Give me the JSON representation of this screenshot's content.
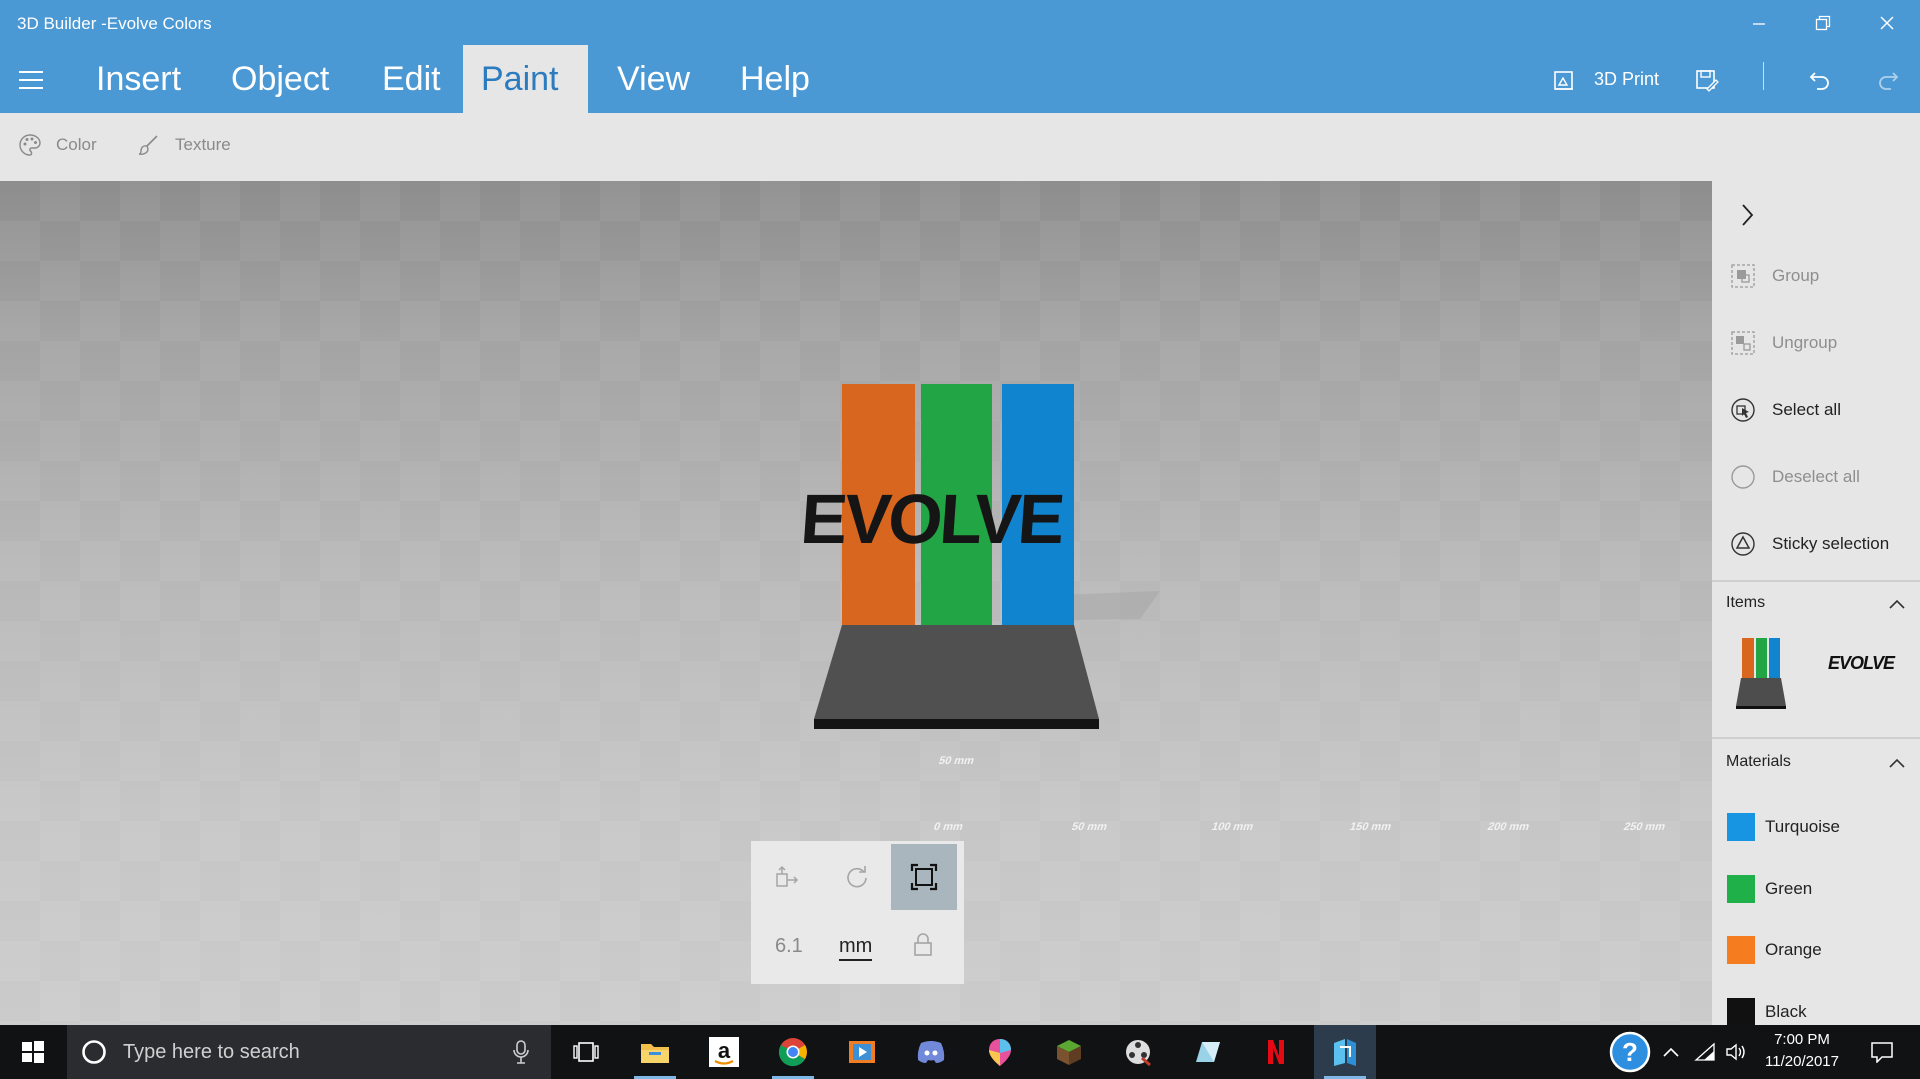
{
  "window": {
    "title": "3D Builder -Evolve Colors"
  },
  "menu": {
    "tabs": [
      {
        "label": "Insert"
      },
      {
        "label": "Object"
      },
      {
        "label": "Edit"
      },
      {
        "label": "Paint",
        "active": true
      },
      {
        "label": "View"
      },
      {
        "label": "Help"
      }
    ],
    "print_label": "3D Print"
  },
  "subtoolbar": {
    "color_label": "Color",
    "texture_label": "Texture"
  },
  "viewport": {
    "model_text": "EVOLVE",
    "bar_colors": [
      "#d9661e",
      "#22a545",
      "#1184d0"
    ],
    "scale_labels": [
      "50 mm",
      "0 mm",
      "50 mm",
      "100 mm",
      "150 mm",
      "200 mm",
      "250 mm"
    ]
  },
  "transform": {
    "value": "6.1",
    "unit": "mm"
  },
  "panel": {
    "group": "Group",
    "ungroup": "Ungroup",
    "select_all": "Select all",
    "deselect_all": "Deselect all",
    "sticky_selection": "Sticky selection",
    "items_header": "Items",
    "item_label": "EVOLVE",
    "materials_header": "Materials",
    "materials": [
      {
        "name": "Turquoise",
        "color": "#1795e3"
      },
      {
        "name": "Green",
        "color": "#20b04a"
      },
      {
        "name": "Orange",
        "color": "#f57d1f"
      },
      {
        "name": "Black",
        "color": "#111111"
      }
    ]
  },
  "taskbar": {
    "search_placeholder": "Type here to search",
    "time": "7:00 PM",
    "date": "11/20/2017"
  },
  "colors": {
    "accent": "#4a98d4",
    "panel": "#e6e6e6",
    "taskbar": "#111214"
  }
}
